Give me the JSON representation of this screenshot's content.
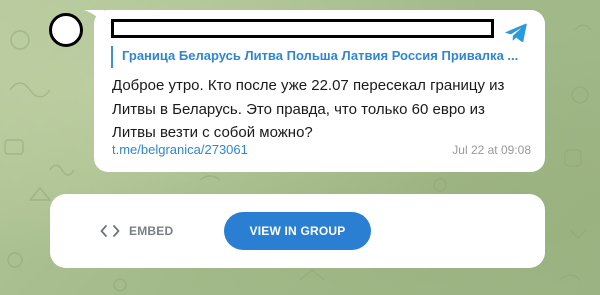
{
  "post": {
    "preview_title": "Граница Беларусь Литва Польша Латвия Россия Привалка ...",
    "message_line1": "Доброе утро. Кто после уже 22.07 пересекал границу из",
    "message_line2": "Литвы в Беларусь. Это правда, что только 60 евро из",
    "message_line3": "Литвы везти с собой можно?",
    "link": "t.me/belgranica/273061",
    "timestamp": "Jul 22 at 09:08"
  },
  "actions": {
    "embed_label": "EMBED",
    "view_label": "VIEW IN GROUP"
  },
  "icons": {
    "share": "telegram-share-icon",
    "embed": "code-brackets-icon"
  },
  "colors": {
    "accent": "#2b7fd2",
    "link": "#2f86d2",
    "background": "#a7bd8f"
  }
}
